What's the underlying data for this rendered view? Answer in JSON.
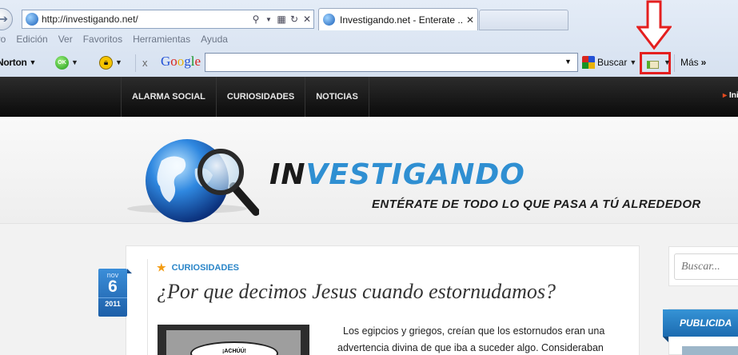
{
  "browser": {
    "url": "http://investigando.net/",
    "tab_title": "Investigando.net - Enterate ...",
    "menu": [
      "ivo",
      "Edición",
      "Ver",
      "Favoritos",
      "Herramientas",
      "Ayuda"
    ],
    "toolbar": {
      "norton_label": "Norton",
      "ok_label": "OK",
      "google_letters": [
        "G",
        "o",
        "o",
        "g",
        "l",
        "e"
      ],
      "search_value": "",
      "buscar_label": "Buscar",
      "more_label": "Más",
      "close_glyph": "x"
    },
    "highlight_color": "#e41f1f"
  },
  "site": {
    "nav": [
      "ALARMA SOCIAL",
      "CURIOSIDADES",
      "NOTICIAS"
    ],
    "nav_right": "Ini",
    "logo_in": "IN",
    "logo_rest": "VESTIGANDO",
    "tagline": "ENTÉRATE DE TODO LO QUE PASA A TÚ ALREDEDOR"
  },
  "post": {
    "date": {
      "month": "nov",
      "day": "6",
      "year": "2011"
    },
    "category": "CURIOSIDADES",
    "title": "¿Por que decimos Jesus cuando estornudamos?",
    "image_caption": "¡ACHÚÚ!",
    "excerpt": "Los egipcios y griegos, creían que los estornudos eran una advertencia divina de que iba a suceder algo. Consideraban"
  },
  "sidebar": {
    "search_placeholder": "Buscar...",
    "widget_title": "PUBLICIDA"
  },
  "colors": {
    "accent": "#2b86c8",
    "nav_bg": "#111111",
    "badge": "#2a78c4"
  }
}
